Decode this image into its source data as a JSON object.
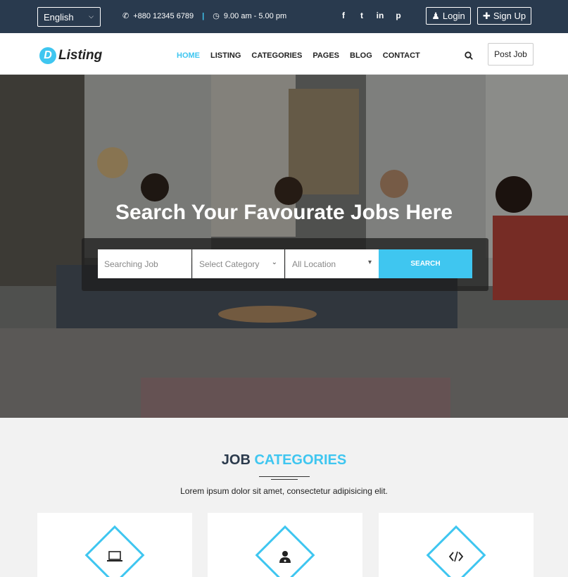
{
  "topbar": {
    "language": "English",
    "phone": "+880 12345 6789",
    "hours": "9.00 am - 5.00 pm",
    "social": [
      "f",
      "t",
      "in",
      "p"
    ],
    "login_label": "Login",
    "signup_label": "Sign Up"
  },
  "nav": {
    "logo_letter": "D",
    "logo_text": "Listing",
    "items": [
      "HOME",
      "LISTING",
      "CATEGORIES",
      "PAGES",
      "BLOG",
      "CONTACT"
    ],
    "active": "HOME",
    "post_job_label": "Post Job"
  },
  "hero": {
    "title": "Search Your Favourate Jobs Here",
    "search_placeholder": "Searching Job",
    "category_placeholder": "Select Category",
    "location_placeholder": "All Location",
    "search_button": "SEARCH"
  },
  "categories": {
    "title_part1": "JOB",
    "title_part2": "CATEGORIES",
    "subtitle": "Lorem ipsum dolor sit amet, consectetur adipisicing elit.",
    "cards": [
      {
        "icon": "laptop-icon"
      },
      {
        "icon": "doctor-icon"
      },
      {
        "icon": "code-icon"
      }
    ]
  },
  "colors": {
    "accent": "#3fc6f0",
    "topbar": "#293a4e"
  }
}
